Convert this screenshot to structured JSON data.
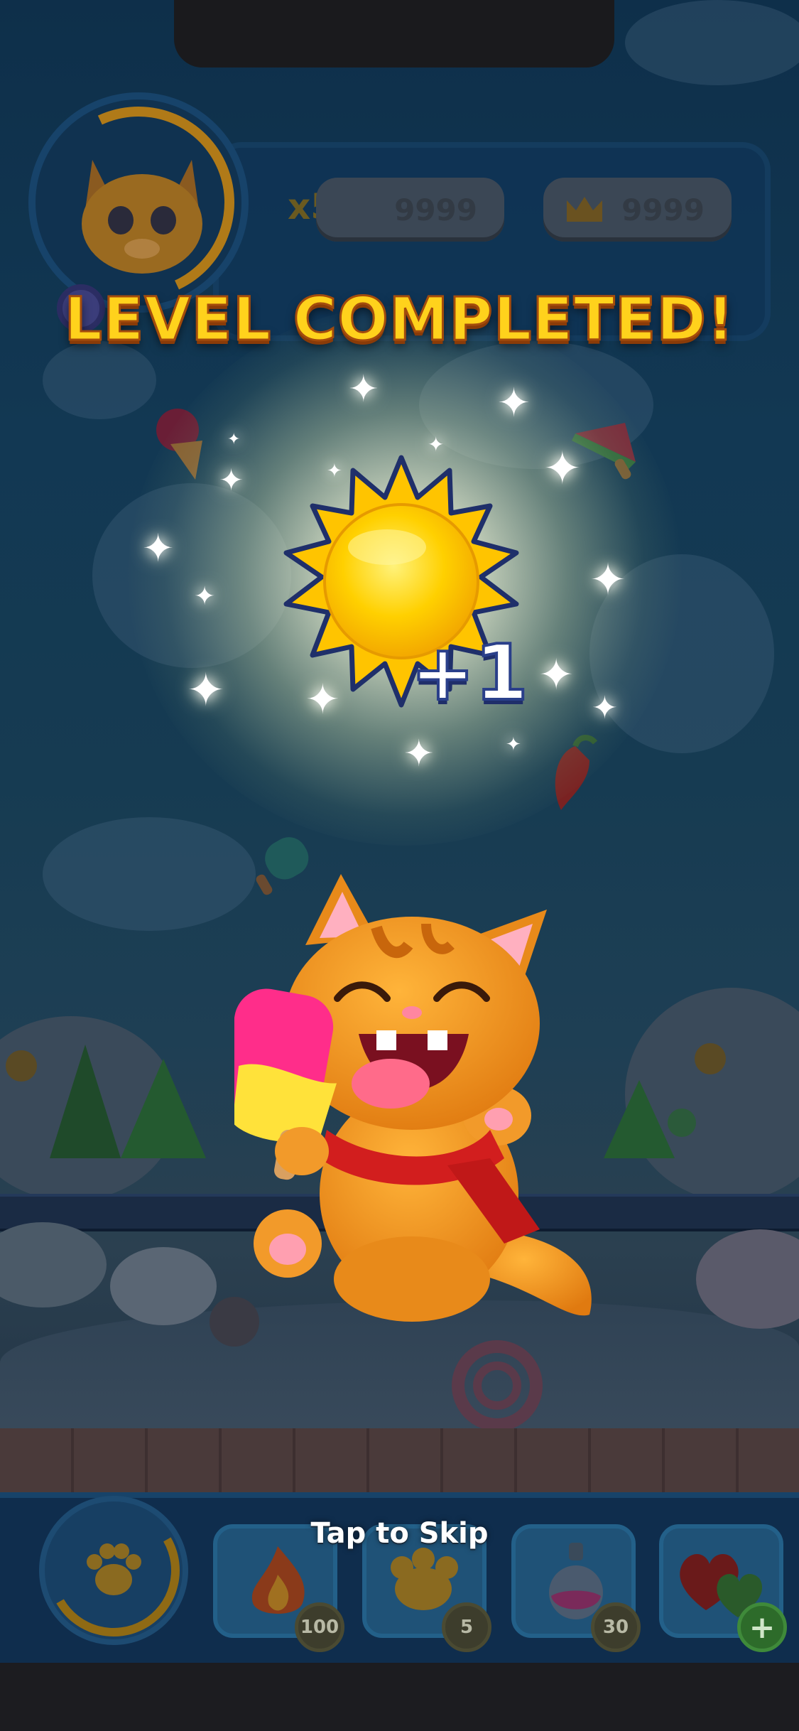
{
  "hud": {
    "multiplier": "x5",
    "coins": "9999",
    "crowns": "9999"
  },
  "title": "LEVEL COMPLETED!",
  "reward": {
    "icon": "sun-icon",
    "amount": "+1"
  },
  "character": "cat-with-ice-cream",
  "skip_label": "Tap to Skip",
  "boosters": [
    {
      "icon": "fire-icon",
      "count": "100"
    },
    {
      "icon": "paw-cookie-icon",
      "count": "5"
    },
    {
      "icon": "potion-icon",
      "count": "30"
    },
    {
      "icon": "hearts-icon",
      "count": "+"
    }
  ],
  "colors": {
    "title_fill": "#ffd21c",
    "title_outline": "#a44c0c",
    "sun": "#ffd400",
    "background": "#163b52"
  }
}
